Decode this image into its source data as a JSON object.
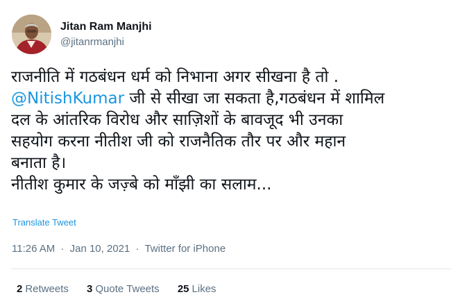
{
  "author": {
    "name": "Jitan Ram Manjhi",
    "handle": "@jitanrmanjhi"
  },
  "tweet": {
    "line1": "राजनीति में गठबंधन धर्म को निभाना अगर सीखना है तो .",
    "mention": "@NitishKumar",
    "line2_rest": " जी से सीखा जा सकता है,गठबंधन में शामिल",
    "line3": "दल के आंतरिक विरोध और साज़िशों के बावजूद भी उनका",
    "line4": "सहयोग करना नीतीश जी को राजनैतिक तौर पर और महान",
    "line5": "बनाता है।",
    "line6": "नीतीश कुमार के जज़्बे को माँझी का सलाम..."
  },
  "translate_label": "Translate Tweet",
  "meta": {
    "time": "11:26 AM",
    "separator1": "·",
    "date": "Jan 10, 2021",
    "separator2": "·",
    "source": "Twitter for iPhone"
  },
  "stats": {
    "retweets_count": "2",
    "retweets_label": "Retweets",
    "quotes_count": "3",
    "quotes_label": "Quote Tweets",
    "likes_count": "25",
    "likes_label": "Likes"
  },
  "colors": {
    "accent": "#1b95e0",
    "secondary_text": "#5b7083",
    "primary_text": "#0f1419",
    "divider": "#e1e8ed"
  }
}
